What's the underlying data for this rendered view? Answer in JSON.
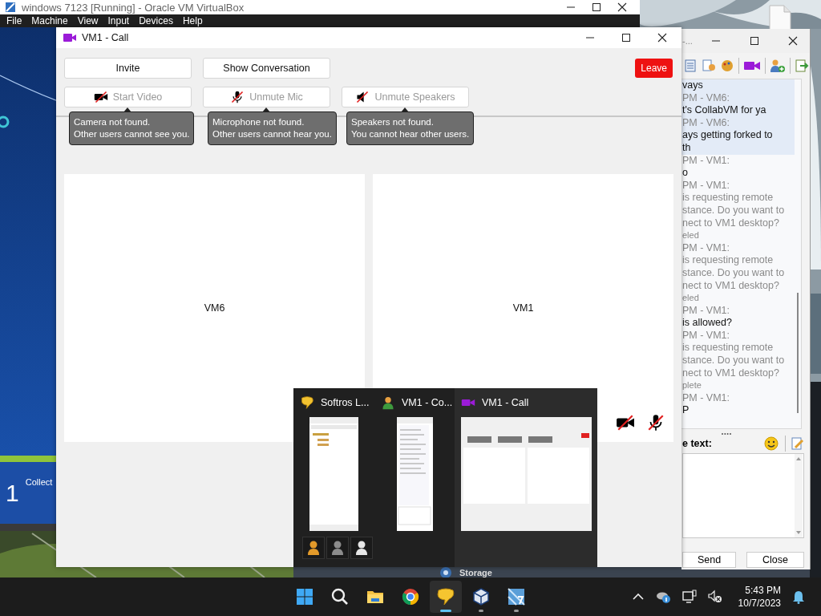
{
  "virtualbox": {
    "title": "windows 7123 [Running] - Oracle VM VirtualBox",
    "menu": [
      "File",
      "Machine",
      "View",
      "Input",
      "Devices",
      "Help"
    ],
    "vm_screen": {
      "kind": "picture",
      "tile_number": "1",
      "tile_label": "Collect"
    }
  },
  "desktop_icons": [
    {
      "kind": "file"
    },
    {
      "kind": "disk",
      "label": "Storage"
    }
  ],
  "chat_window": {
    "title": "-...",
    "messages": [
      {
        "highlighted": true,
        "kind": "text",
        "lines": [
          "vays"
        ]
      },
      {
        "highlighted": true,
        "kind": "text",
        "header": "PM - VM6:",
        "lines": [
          "t's CollabVM for ya"
        ]
      },
      {
        "highlighted": true,
        "kind": "text",
        "header": "PM - VM6:",
        "lines": [
          "ays getting forked to",
          "th"
        ]
      },
      {
        "highlighted": false,
        "kind": "text",
        "header": "PM - VM1:",
        "lines": [
          "o"
        ]
      },
      {
        "highlighted": false,
        "kind": "system",
        "header": "PM - VM1:",
        "lines": [
          "is requesting remote",
          "stance. Do you want to",
          "nect to VM1 desktop?"
        ],
        "status": "eled"
      },
      {
        "highlighted": false,
        "kind": "system",
        "header": "PM - VM1:",
        "lines": [
          "is requesting remote",
          "stance. Do you want to",
          "nect to VM1 desktop?"
        ],
        "status": "eled"
      },
      {
        "highlighted": false,
        "kind": "text",
        "header": "PM - VM1:",
        "lines": [
          "is allowed?"
        ]
      },
      {
        "highlighted": false,
        "kind": "system",
        "header": "PM - VM1:",
        "lines": [
          "is requesting remote",
          "stance. Do you want to",
          "nect to VM1 desktop?"
        ],
        "status": "plete"
      },
      {
        "highlighted": false,
        "kind": "text",
        "header": "PM - VM1:",
        "lines": [
          "P"
        ]
      }
    ],
    "compose_label": "e text:",
    "buttons": [
      {
        "label": "Send"
      },
      {
        "label": "Close"
      }
    ]
  },
  "call_window": {
    "title": "VM1 - Call",
    "actions": [
      {
        "label": "Invite"
      },
      {
        "label": "Show Conversation"
      }
    ],
    "leave": {
      "label": "Leave"
    },
    "media": [
      {
        "kind": "camera",
        "label": "Start Video",
        "disabled": true,
        "tooltip": "Camera not found.\nOther users cannot see you."
      },
      {
        "kind": "mic",
        "label": "Unmute Mic",
        "disabled": true,
        "tooltip": "Microphone not found.\nOther users cannot hear you."
      },
      {
        "kind": "speaker",
        "label": "Unmute Speakers",
        "disabled": true,
        "tooltip": "Speakers not found.\nYou cannot hear other users."
      }
    ],
    "participants": [
      {
        "name": "VM6"
      },
      {
        "name": "VM1"
      }
    ],
    "self_status": [
      {
        "kind": "camera",
        "off": true
      },
      {
        "kind": "mic",
        "off": true
      }
    ]
  },
  "switcher": {
    "items": [
      {
        "title": "Softros L...",
        "kind": "messenger",
        "selected": false
      },
      {
        "title": "VM1 - Co...",
        "kind": "conversation",
        "selected": false
      },
      {
        "title": "VM1 - Call",
        "kind": "call",
        "selected": true
      }
    ],
    "group_icons": [
      {
        "color": "#e39a2a"
      },
      {
        "color": "#8c8c8c"
      },
      {
        "color": "#e6e6e6"
      }
    ]
  },
  "taskbar": {
    "apps": [
      {
        "kind": "start",
        "running": false,
        "selected": false
      },
      {
        "kind": "search",
        "running": false,
        "selected": false
      },
      {
        "kind": "folder",
        "running": false,
        "selected": false
      },
      {
        "kind": "browser",
        "running": false,
        "selected": false
      },
      {
        "kind": "chat",
        "running": true,
        "selected": true
      },
      {
        "kind": "vbox",
        "running": true,
        "selected": false
      },
      {
        "kind": "app7",
        "running": true,
        "selected": false
      }
    ],
    "time": "5:43 PM",
    "date": "10/7/2023"
  }
}
